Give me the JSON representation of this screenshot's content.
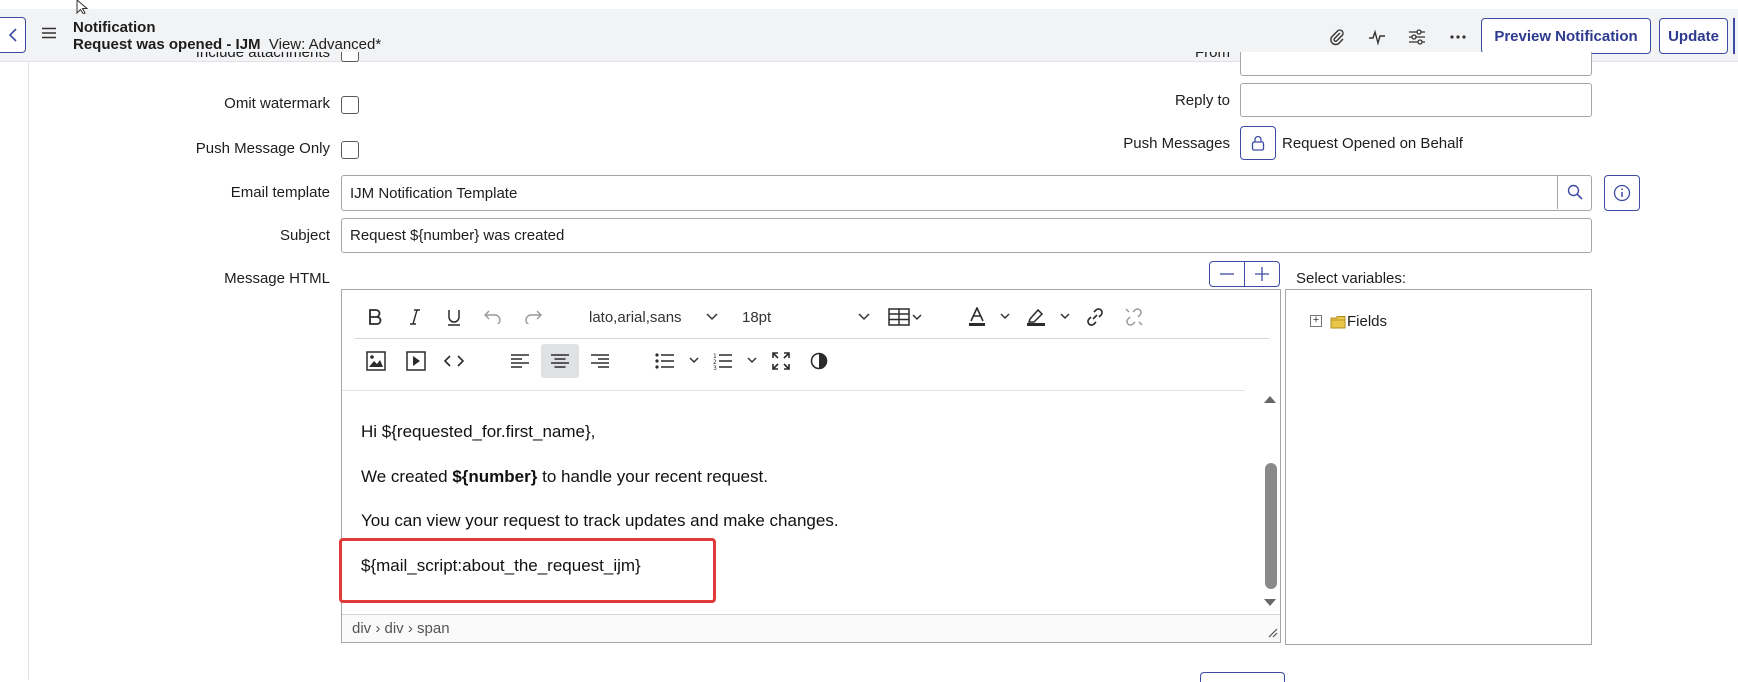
{
  "header": {
    "record_type": "Notification",
    "record_name": "Request was opened - IJM",
    "view_label": "View: Advanced*",
    "icons": [
      "paperclip-icon",
      "activity-icon",
      "sliders-icon",
      "more-icon"
    ],
    "preview_button": "Preview Notification",
    "update_button": "Update"
  },
  "form": {
    "include_attachments_label": "Include attachments",
    "omit_watermark_label": "Omit watermark",
    "push_message_only_label": "Push Message Only",
    "from_label": "From",
    "reply_to_label": "Reply to",
    "push_messages_label": "Push Messages",
    "push_messages_value": "Request Opened on Behalf",
    "email_template_label": "Email template",
    "email_template_value": "IJM Notification Template",
    "subject_label": "Subject",
    "subject_value": "Request ${number} was created",
    "message_html_label": "Message HTML"
  },
  "editor": {
    "font_family": "lato,arial,sans",
    "font_size": "18pt",
    "content": {
      "line1": "Hi ${requested_for.first_name},",
      "line2_pre": "We created ",
      "line2_bold": "${number}",
      "line2_post": " to handle your recent request.",
      "line3": "You can view your request to track updates and make changes.",
      "line4": "${mail_script:about_the_request_ijm}"
    },
    "status_path": "div › div › span",
    "highlight_color": "#e03a3a"
  },
  "variables": {
    "label": "Select variables:",
    "tree_root": "Fields"
  },
  "colors": {
    "accent": "#3d4ca3",
    "header_bg": "#f2f3f5"
  }
}
